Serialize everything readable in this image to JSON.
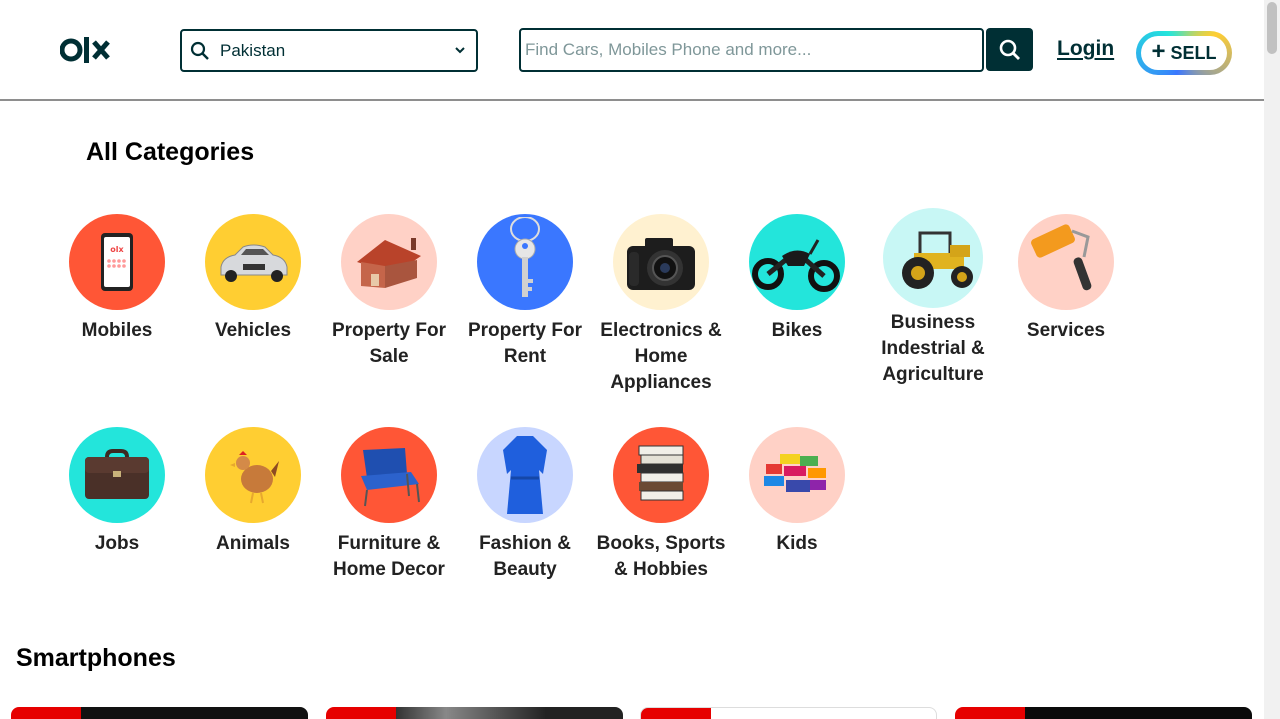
{
  "header": {
    "location_value": "Pakistan",
    "search_placeholder": "Find Cars, Mobiles Phone and more...",
    "login_label": "Login",
    "sell_label": "SELL",
    "sell_plus": "+"
  },
  "sections": {
    "categories_title": "All Categories",
    "smartphones_title": "Smartphones"
  },
  "categories": [
    {
      "label": "Mobiles",
      "icon": "mobile-phone-icon",
      "color": "#ff5636"
    },
    {
      "label": "Vehicles",
      "icon": "car-icon",
      "color": "#ffce32"
    },
    {
      "label": "Property For Sale",
      "icon": "house-icon",
      "color": "#ffd1c6"
    },
    {
      "label": "Property For Rent",
      "icon": "key-icon",
      "color": "#3a77ff"
    },
    {
      "label": "Electronics & Home Appliances",
      "icon": "camera-icon",
      "color": "#fff1d0"
    },
    {
      "label": "Bikes",
      "icon": "motorbike-icon",
      "color": "#23e5db"
    },
    {
      "label": "Business Indestrial & Agriculture",
      "icon": "tractor-icon",
      "color": "#c8f7f5"
    },
    {
      "label": "Services",
      "icon": "paint-roller-icon",
      "color": "#ffd1c6"
    },
    {
      "label": "Jobs",
      "icon": "briefcase-icon",
      "color": "#23e5db"
    },
    {
      "label": "Animals",
      "icon": "hen-icon",
      "color": "#ffce32"
    },
    {
      "label": "Furniture & Home Decor",
      "icon": "armchair-icon",
      "color": "#ff5636"
    },
    {
      "label": "Fashion & Beauty",
      "icon": "dress-icon",
      "color": "#c8d6ff"
    },
    {
      "label": "Books, Sports & Hobbies",
      "icon": "books-icon",
      "color": "#ff5636"
    },
    {
      "label": "Kids",
      "icon": "toy-blocks-icon",
      "color": "#ffd1c6"
    }
  ],
  "colors": {
    "brand_dark": "#002f34",
    "card_accent": "#e60000"
  }
}
